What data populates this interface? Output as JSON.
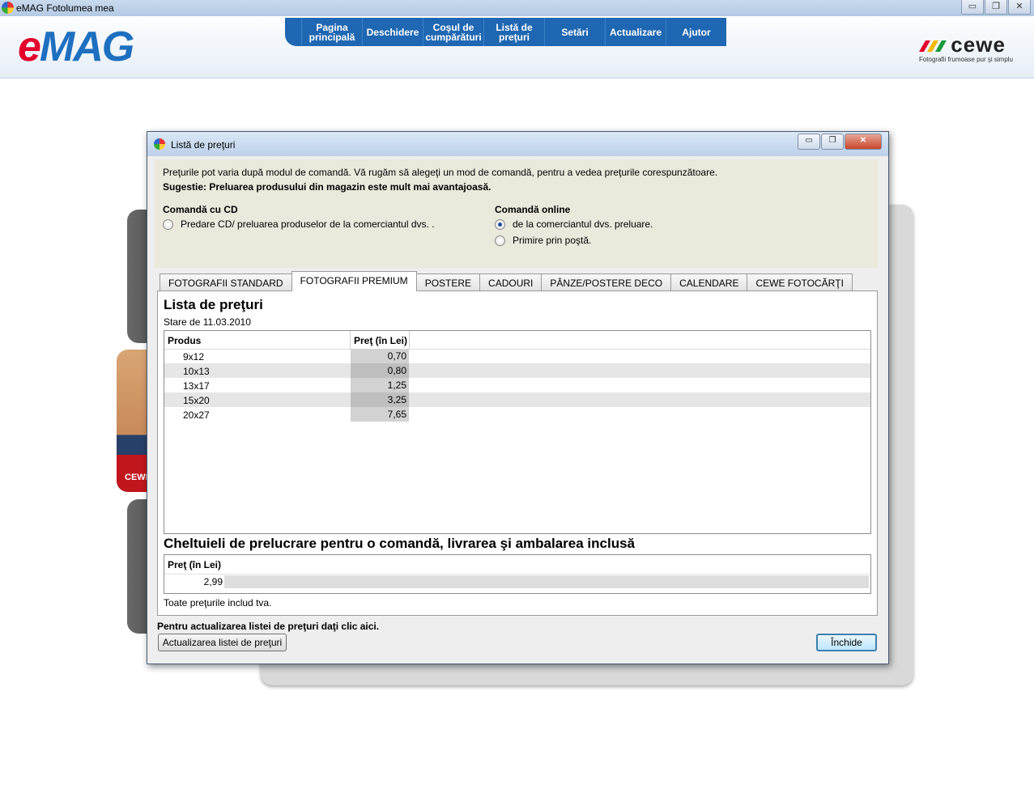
{
  "window": {
    "title": "eMAG Fotolumea mea",
    "controls": [
      "▭",
      "❐",
      "✕"
    ]
  },
  "header": {
    "logo_e": "e",
    "logo_mag": "MAG",
    "nav": [
      {
        "label": "Pagina\nprincipală"
      },
      {
        "label": "Deschidere"
      },
      {
        "label": "Coşul de\ncumpărături"
      },
      {
        "label": "Listă de\npreţuri"
      },
      {
        "label": "Setări"
      },
      {
        "label": "Actualizare"
      },
      {
        "label": "Ajutor"
      }
    ],
    "cewe_word": "cewe",
    "cewe_tagline": "Fotografii frumoase pur şi simplu"
  },
  "background": {
    "tile_label": "CEWE"
  },
  "dialog": {
    "title": "Listă de preţuri",
    "controls": [
      "▭",
      "❐",
      "✕"
    ],
    "info_line": "Preţurile pot varia după modul de comandă. Vă rugăm să alegeţi un mod de comandă, pentru a vedea preţurile corespunzătoare.",
    "suggestion": "Sugestie: Preluarea produsului din magazin este mult mai avantajoasă.",
    "cd_group": {
      "title": "Comandă cu CD",
      "options": [
        {
          "label": "Predare CD/ preluarea produselor de la comerciantul dvs. .",
          "selected": false
        }
      ]
    },
    "online_group": {
      "title": "Comandă online",
      "options": [
        {
          "label": "de la comerciantul dvs. preluare.",
          "selected": true
        },
        {
          "label": "Primire prin poştă.",
          "selected": false
        }
      ]
    },
    "tabs": [
      {
        "label": "FOTOGRAFII STANDARD",
        "active": false
      },
      {
        "label": "FOTOGRAFII PREMIUM",
        "active": true
      },
      {
        "label": "POSTERE",
        "active": false
      },
      {
        "label": "CADOURI",
        "active": false
      },
      {
        "label": "PÂNZE/POSTERE DECO",
        "active": false
      },
      {
        "label": "CALENDARE",
        "active": false
      },
      {
        "label": "CEWE FOTOCĂRŢI",
        "active": false
      }
    ],
    "price_list": {
      "title": "Lista de preţuri",
      "state": "Stare de 11.03.2010",
      "columns": [
        "Produs",
        "Preţ (în Lei)"
      ],
      "rows": [
        {
          "product": "9x12",
          "price": "0,70"
        },
        {
          "product": "10x13",
          "price": "0,80"
        },
        {
          "product": "13x17",
          "price": "1,25"
        },
        {
          "product": "15x20",
          "price": "3,25"
        },
        {
          "product": "20x27",
          "price": "7,65"
        }
      ]
    },
    "costs": {
      "title": "Cheltuieli de prelucrare pentru o comandă, livrarea şi ambalarea inclusă",
      "column": "Preţ (în Lei)",
      "value": "2,99"
    },
    "vat_note": "Toate preţurile includ tva.",
    "update_hint": "Pentru actualizarea listei de preţuri daţi clic aici.",
    "update_button": "Actualizarea listei de preţuri",
    "close_button": "Închide"
  }
}
